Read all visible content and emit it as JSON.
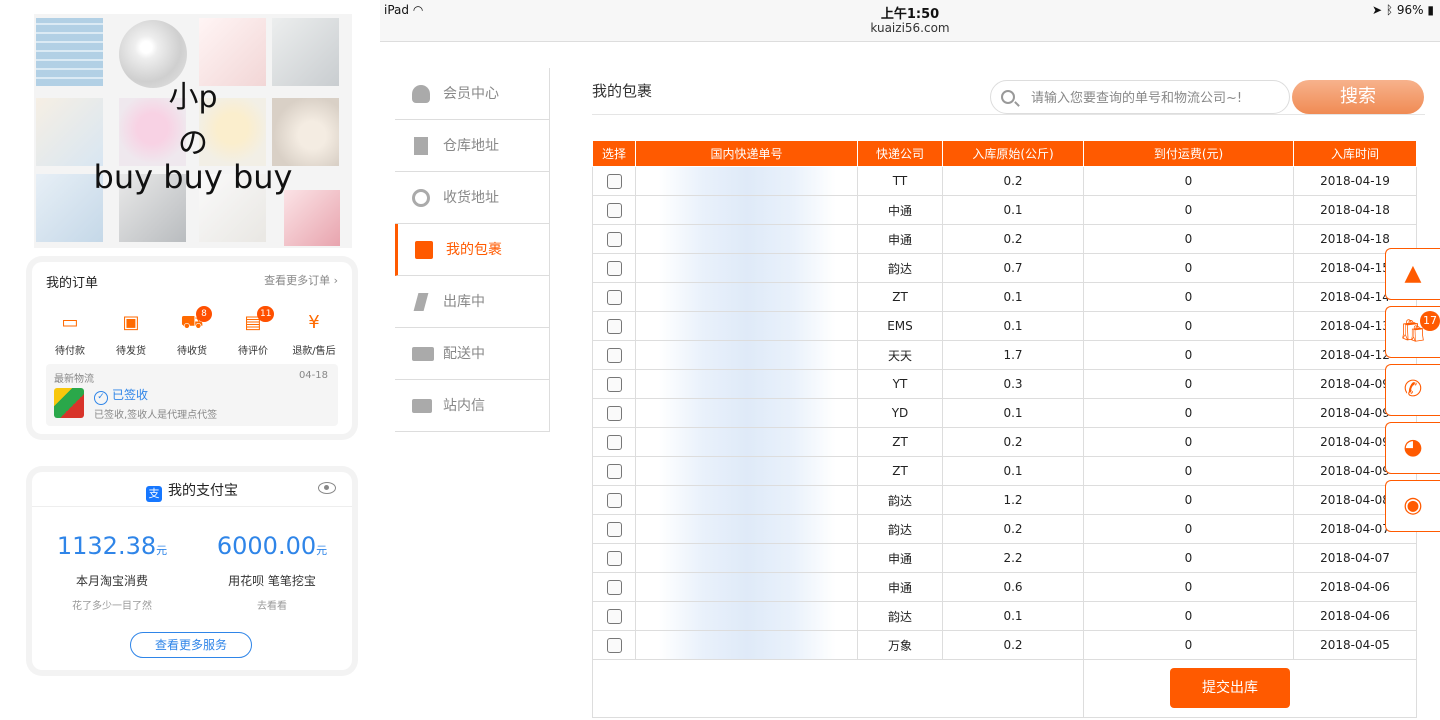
{
  "collage": {
    "line1": "小p",
    "line2": "の",
    "line3": "buy buy buy"
  },
  "orders": {
    "title": "我的订单",
    "more": "查看更多订单 ›",
    "items": [
      {
        "label": "待付款",
        "icon": "wallet-icon",
        "badge": ""
      },
      {
        "label": "待发货",
        "icon": "package-icon",
        "badge": ""
      },
      {
        "label": "待收货",
        "icon": "truck-icon",
        "badge": "8"
      },
      {
        "label": "待评价",
        "icon": "comment-icon",
        "badge": "11"
      },
      {
        "label": "退款/售后",
        "icon": "refund-icon",
        "badge": ""
      }
    ],
    "logistics": {
      "title": "最新物流",
      "date": "04-18",
      "status": "已签收",
      "desc": "已签收,签收人是代理点代签"
    }
  },
  "alipay": {
    "title": "我的支付宝",
    "col1": {
      "amount": "1132.38",
      "unit": "元",
      "label": "本月淘宝消费",
      "hint": "花了多少一目了然"
    },
    "col2": {
      "amount": "6000.00",
      "unit": "元",
      "label": "用花呗 笔笔挖宝",
      "hint": "去看看"
    },
    "button": "查看更多服务"
  },
  "statusbar": {
    "device": "iPad",
    "time": "上午1:50",
    "url": "kuaizi56.com",
    "battery": "96%"
  },
  "sidenav": {
    "items": [
      {
        "label": "会员中心",
        "icon": "user-icon"
      },
      {
        "label": "仓库地址",
        "icon": "building-icon"
      },
      {
        "label": "收货地址",
        "icon": "link-icon"
      },
      {
        "label": "我的包裹",
        "icon": "gift-icon",
        "active": true
      },
      {
        "label": "出库中",
        "icon": "bolt-icon"
      },
      {
        "label": "配送中",
        "icon": "truck-icon"
      },
      {
        "label": "站内信",
        "icon": "mail-icon"
      }
    ]
  },
  "content": {
    "title": "我的包裹",
    "search_placeholder": "请输入您要查询的单号和物流公司~!",
    "search_button": "搜索",
    "submit_button": "提交出库"
  },
  "table": {
    "headers": [
      "选择",
      "国内快递单号",
      "快递公司",
      "入库原始(公斤)",
      "到付运费(元)",
      "入库时间"
    ],
    "rows": [
      {
        "company": "TT",
        "weight": "0.2",
        "fee": "0",
        "date": "2018-04-19"
      },
      {
        "company": "中通",
        "weight": "0.1",
        "fee": "0",
        "date": "2018-04-18"
      },
      {
        "company": "申通",
        "weight": "0.2",
        "fee": "0",
        "date": "2018-04-18"
      },
      {
        "company": "韵达",
        "weight": "0.7",
        "fee": "0",
        "date": "2018-04-15"
      },
      {
        "company": "ZT",
        "weight": "0.1",
        "fee": "0",
        "date": "2018-04-14"
      },
      {
        "company": "EMS",
        "weight": "0.1",
        "fee": "0",
        "date": "2018-04-13"
      },
      {
        "company": "天天",
        "weight": "1.7",
        "fee": "0",
        "date": "2018-04-12"
      },
      {
        "company": "YT",
        "weight": "0.3",
        "fee": "0",
        "date": "2018-04-09"
      },
      {
        "company": "YD",
        "weight": "0.1",
        "fee": "0",
        "date": "2018-04-09"
      },
      {
        "company": "ZT",
        "weight": "0.2",
        "fee": "0",
        "date": "2018-04-09"
      },
      {
        "company": "ZT",
        "weight": "0.1",
        "fee": "0",
        "date": "2018-04-09"
      },
      {
        "company": "韵达",
        "weight": "1.2",
        "fee": "0",
        "date": "2018-04-08"
      },
      {
        "company": "韵达",
        "weight": "0.2",
        "fee": "0",
        "date": "2018-04-07"
      },
      {
        "company": "申通",
        "weight": "2.2",
        "fee": "0",
        "date": "2018-04-07"
      },
      {
        "company": "申通",
        "weight": "0.6",
        "fee": "0",
        "date": "2018-04-06"
      },
      {
        "company": "韵达",
        "weight": "0.1",
        "fee": "0",
        "date": "2018-04-06"
      },
      {
        "company": "万象",
        "weight": "0.2",
        "fee": "0",
        "date": "2018-04-05"
      }
    ]
  },
  "floatbar": {
    "items": [
      {
        "icon": "arrow-up-icon",
        "glyph": "▲"
      },
      {
        "icon": "shopping-bag-icon",
        "glyph": "🛍",
        "badge": "17"
      },
      {
        "icon": "phone-icon",
        "glyph": "✆"
      },
      {
        "icon": "qq-icon",
        "glyph": "◕"
      },
      {
        "icon": "wechat-icon",
        "glyph": "◉"
      }
    ]
  },
  "colors": {
    "accent": "#ff5a00",
    "link": "#2f85e8"
  }
}
